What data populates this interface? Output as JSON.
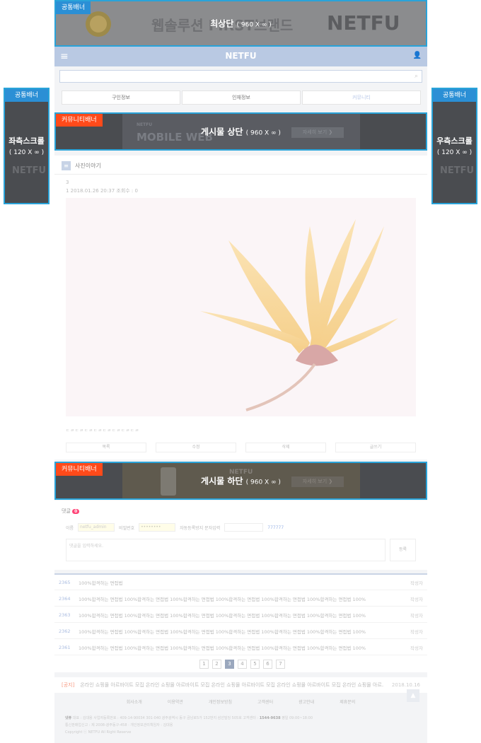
{
  "top_banner": {
    "tag": "공통배너",
    "caption": "최상단",
    "size": "( 960 X ∞ )",
    "bg_text_1": "웹솔루션 FIRST브랜드",
    "bg_text_2": "NETFU"
  },
  "left_banner": {
    "tag": "공통배너",
    "caption": "좌측스크롤",
    "size": "( 120 X ∞ )",
    "bg_text": "NETFU"
  },
  "right_banner": {
    "tag": "공통배너",
    "caption": "우측스크롤",
    "size": "( 120 X ∞ )",
    "bg_text": "NETFU"
  },
  "header": {
    "logo": "NETFU",
    "menu_icon": "≡",
    "user_icon": "👤"
  },
  "search": {
    "placeholder": "",
    "icon": "search-icon"
  },
  "tabs": [
    {
      "label": "구인정보"
    },
    {
      "label": "인재정보"
    },
    {
      "label": "커뮤니티"
    }
  ],
  "community_top_banner": {
    "tag": "커뮤니티배너",
    "caption": "게시물 상단",
    "size": "( 960 X ∞ )",
    "bg_text": "MOBILE WEB",
    "bg_small": "NETFU",
    "btn": "자세히 보기 ❯"
  },
  "community_bottom_banner": {
    "tag": "커뮤니티배너",
    "caption": "게시물 하단",
    "size": "( 960 X ∞ )",
    "bg_text": "NETFU",
    "btn": "자세히 보기 ❯"
  },
  "board": {
    "title": "사진이야기",
    "post_no": "3",
    "meta": "1 2018.01.26 20:37 조회수 : 0",
    "body": "ㄷㄹㄷㄹㄷㄹㄷㄹㄷㄹㄷㄹㄷㄹㄷㄹ"
  },
  "actions": [
    {
      "label": "목록"
    },
    {
      "label": "수정"
    },
    {
      "label": "삭제"
    },
    {
      "label": "글쓰기"
    }
  ],
  "comment": {
    "title": "댓글",
    "count": "0",
    "name_label": "이름",
    "name_value": "netfu_admin",
    "pw_label": "비밀번호",
    "pw_value": "••••••••",
    "captcha_label": "자동등록방지 문자입력",
    "captcha_code": "777777",
    "placeholder": "댓글을 입력하세요.",
    "submit": "등록"
  },
  "list": [
    {
      "no": "2365",
      "subject": "100%합격하는 면접법",
      "writer": "작성자"
    },
    {
      "no": "2364",
      "subject": "100%합격하는 면접법 100%합격하는 면접법 100%합격하는 면접법 100%합격하는 면접법 100%합격하는 면접법 100%합격하는 면접법 100%",
      "writer": "작성자"
    },
    {
      "no": "2363",
      "subject": "100%합격하는 면접법 100%합격하는 면접법 100%합격하는 면접법 100%합격하는 면접법 100%합격하는 면접법 100%합격하는 면접법 100%",
      "writer": "작성자"
    },
    {
      "no": "2362",
      "subject": "100%합격하는 면접법 100%합격하는 면접법 100%합격하는 면접법 100%합격하는 면접법 100%합격하는 면접법 100%합격하는 면접법 100%",
      "writer": "작성자"
    },
    {
      "no": "2361",
      "subject": "100%합격하는 면접법 100%합격하는 면접법 100%합격하는 면접법 100%합격하는 면접법 100%합격하는 면접법 100%합격하는 면접법 100%",
      "writer": "작성자"
    }
  ],
  "pager": [
    "1",
    "2",
    "3",
    "4",
    "5",
    "6",
    "7"
  ],
  "notice": {
    "label": "[공지]",
    "text": "온라인 쇼핑몰 아르바이트 모집 온라인 쇼핑몰 아르바이트 모집 온라인 쇼핑몰 아르바이트 모집 온라인 쇼핑몰 아르바이트 모집 온라인 쇼핑몰 아르…",
    "date": "2018.10.16"
  },
  "footer_links": [
    "회사소개",
    "이용약관",
    "개인정보방침",
    "고객센터",
    "광고안내",
    "제휴문의"
  ],
  "footer": {
    "line1_label": "넷퓨",
    "line1": "대표 : 김대용  사업자등록번호 : 409-14-90034  301-040 광주광역시 동구 금남로5가 152번지 삼선빌딩 505호 고객센터 :",
    "phone": "1544-9638",
    "hours": "평일 09:00~18:00",
    "line2": "통신판매업신고 : 제 2008-광주동구-458 · 개인정보관리책임자 : 김대용",
    "line3": "Copyright ⓒ NETFU All Right Reserve"
  }
}
